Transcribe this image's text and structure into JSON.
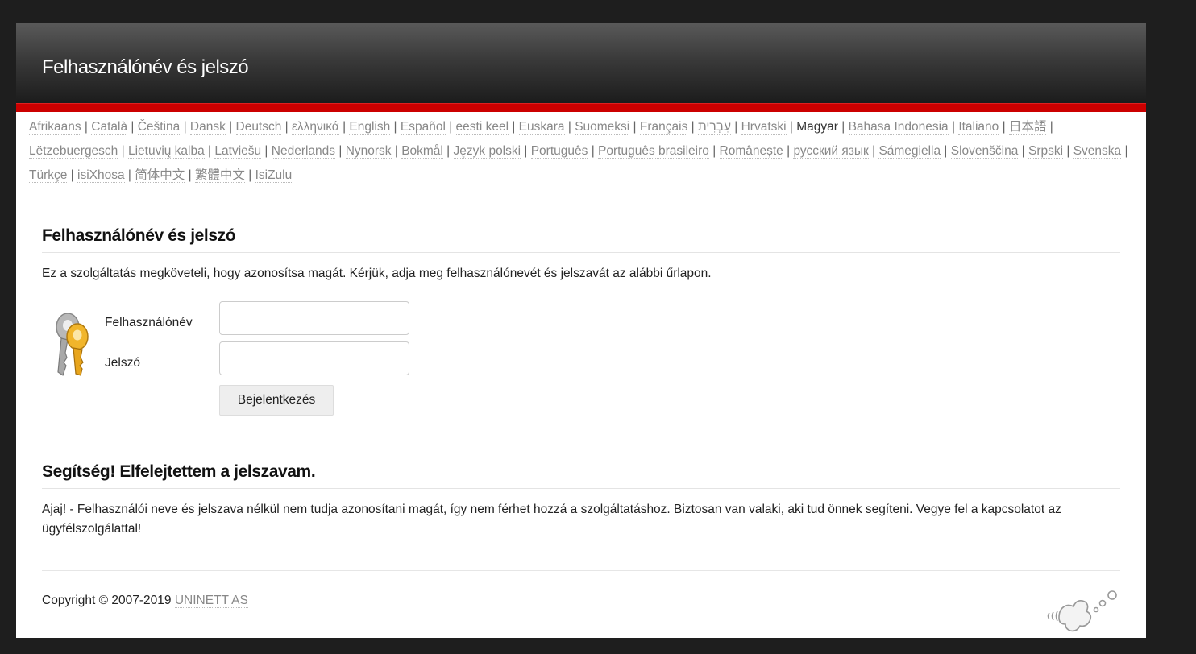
{
  "header": {
    "title": "Felhasználónév és jelszó"
  },
  "languages": [
    {
      "label": "Afrikaans"
    },
    {
      "label": "Català"
    },
    {
      "label": "Čeština"
    },
    {
      "label": "Dansk"
    },
    {
      "label": "Deutsch"
    },
    {
      "label": "ελληνικά"
    },
    {
      "label": "English"
    },
    {
      "label": "Español"
    },
    {
      "label": "eesti keel"
    },
    {
      "label": "Euskara"
    },
    {
      "label": "Suomeksi"
    },
    {
      "label": "Français"
    },
    {
      "label": "עִבְרִית"
    },
    {
      "label": "Hrvatski"
    },
    {
      "label": "Magyar",
      "current": true
    },
    {
      "label": "Bahasa Indonesia"
    },
    {
      "label": "Italiano"
    },
    {
      "label": "日本語"
    },
    {
      "label": "Lëtzebuergesch"
    },
    {
      "label": "Lietuvių kalba"
    },
    {
      "label": "Latviešu"
    },
    {
      "label": "Nederlands"
    },
    {
      "label": "Nynorsk"
    },
    {
      "label": "Bokmål"
    },
    {
      "label": "Język polski"
    },
    {
      "label": "Português"
    },
    {
      "label": "Português brasileiro"
    },
    {
      "label": "Românește"
    },
    {
      "label": "русский язык"
    },
    {
      "label": "Sámegiella"
    },
    {
      "label": "Slovenščina"
    },
    {
      "label": "Srpski"
    },
    {
      "label": "Svenska"
    },
    {
      "label": "Türkçe"
    },
    {
      "label": "isiXhosa"
    },
    {
      "label": "简体中文"
    },
    {
      "label": "繁體中文"
    },
    {
      "label": "IsiZulu"
    }
  ],
  "login": {
    "heading": "Felhasználónév és jelszó",
    "intro": "Ez a szolgáltatás megköveteli, hogy azonosítsa magát. Kérjük, adja meg felhasználónevét és jelszavát az alábbi űrlapon.",
    "username_label": "Felhasználónév",
    "username_value": "",
    "password_label": "Jelszó",
    "password_value": "",
    "submit_label": "Bejelentkezés"
  },
  "help": {
    "heading": "Segítség! Elfelejtettem a jelszavam.",
    "text": "Ajaj! - Felhasználói neve és jelszava nélkül nem tudja azonosítani magát, így nem férhet hozzá a szolgáltatáshoz. Biztosan van valaki, aki tud önnek segíteni. Vegye fel a kapcsolatot az ügyfélszolgálattal!"
  },
  "footer": {
    "copyright": "Copyright © 2007-2019",
    "company": "UNINETT AS"
  },
  "icons": {
    "login": "keys-icon",
    "logo": "simplesamlphp-logo"
  }
}
